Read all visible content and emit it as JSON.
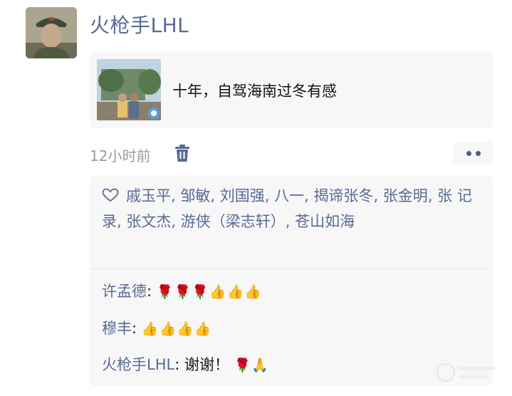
{
  "post": {
    "author": "火枪手LHL",
    "link_title": "十年，自驾海南过冬有感",
    "time": "12小时前"
  },
  "icons": {
    "avatar": "profile-photo",
    "link_thumb": "couple-photo",
    "delete": "trash-icon",
    "more": "more-dots-icon",
    "like": "heart-icon",
    "rose": "rose-emoji",
    "thumbs_up": "thumbs-up-emoji",
    "clap": "pray-hands-emoji"
  },
  "likes": {
    "names": [
      "戚玉平",
      "邹敏",
      "刘国强",
      "八一",
      "揭谛张冬",
      "张金明",
      "张 记录",
      "张文杰",
      "游侠（梁志轩）",
      "苍山如海"
    ],
    "separator": ", "
  },
  "comments": [
    {
      "author": "许孟德",
      "sep": ": ",
      "text": "",
      "emojis": [
        "🌹",
        "🌹",
        "🌹",
        "👍",
        "👍",
        "👍"
      ]
    },
    {
      "author": "穆丰",
      "sep": ": ",
      "text": "",
      "emojis": [
        "👍",
        "👍",
        "👍",
        "👍"
      ]
    },
    {
      "author": "火枪手LHL",
      "sep": ": ",
      "text": "谢谢！",
      "emojis": [
        "🌹",
        "🙏"
      ]
    }
  ],
  "colors": {
    "name_blue": "#576b95",
    "card_bg": "#f7f7f7",
    "time_gray": "#9b9b9b",
    "text": "#1a1a1a"
  }
}
